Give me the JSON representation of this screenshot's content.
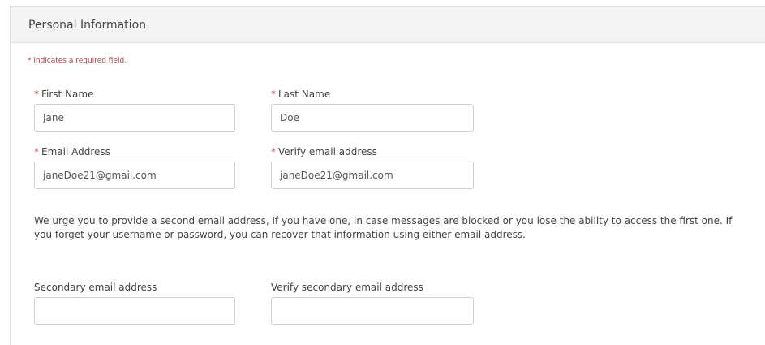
{
  "section": {
    "title": "Personal Information",
    "required_note": "* indicates a required field."
  },
  "fields": {
    "first_name": {
      "required_mark": "*",
      "label": "First Name",
      "value": "Jane"
    },
    "last_name": {
      "required_mark": "*",
      "label": "Last Name",
      "value": "Doe"
    },
    "email": {
      "required_mark": "*",
      "label": "Email Address",
      "value": "janeDoe21@gmail.com"
    },
    "verify_email": {
      "required_mark": "*",
      "label": "Verify email address",
      "value": "janeDoe21@gmail.com"
    },
    "secondary_email": {
      "label": "Secondary email address",
      "value": ""
    },
    "verify_secondary_email": {
      "label": "Verify secondary email address",
      "value": ""
    }
  },
  "info_text": "We urge you to provide a second email address, if you have one, in case messages are blocked or you lose the ability to access the first one. If you forget your username or password, you can recover that information using either email address.",
  "colors": {
    "required": "#b94a48",
    "header_bg": "#f4f4f4",
    "input_border": "#cfcfcf"
  }
}
